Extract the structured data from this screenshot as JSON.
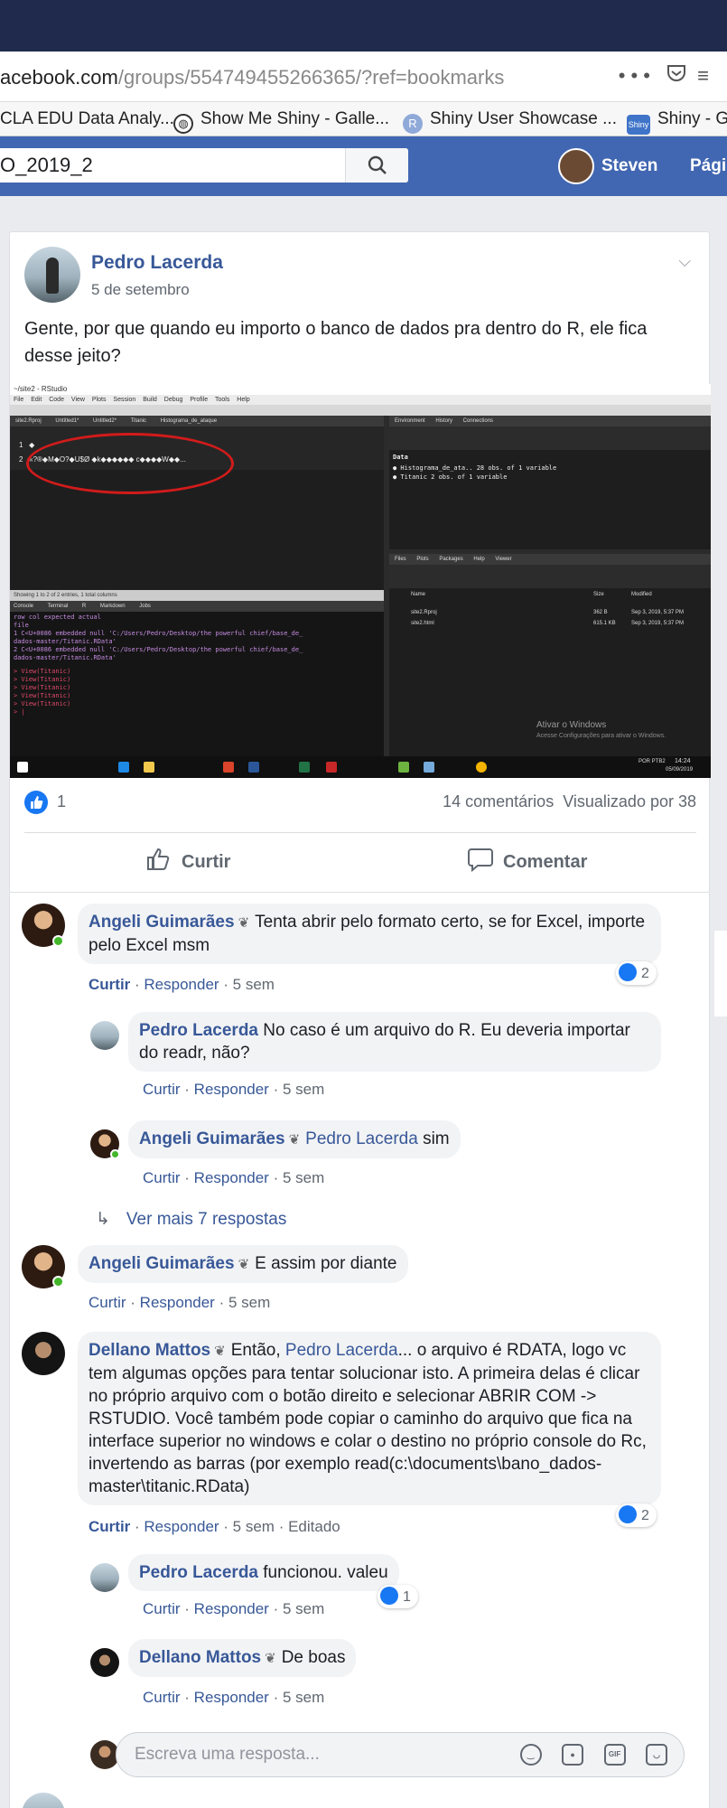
{
  "browser": {
    "url_prefix": "acebook.com",
    "url_path": "/groups/554749455266365/?ref=bookmarks",
    "menu_icon": "more-dots-icon",
    "pocket_icon": "pocket-icon",
    "bookmarks": [
      {
        "label": "CLA EDU Data Analy..."
      },
      {
        "label": "Show Me Shiny - Galle..."
      },
      {
        "label": "Shiny User Showcase ..."
      },
      {
        "label": "Shiny - Ga"
      }
    ]
  },
  "facebook": {
    "search_value": "O_2019_2",
    "user_name": "Steven",
    "page_link": "Pági",
    "brand_color": "#4267b2"
  },
  "post": {
    "author": "Pedro Lacerda",
    "date": "5 de setembro",
    "text": "Gente, por que quando eu importo o banco de dados pra dentro do R, ele fica desse jeito?",
    "like_count": "1",
    "comment_count": "14 comentários",
    "seen_by": "Visualizado por 38",
    "like_button": "Curtir",
    "comment_button": "Comentar"
  },
  "screenshot": {
    "title": "~/site2 - RStudio",
    "menu": "File  Edit  Code  View  Plots  Session  Build  Debug  Profile  Tools  Help",
    "left_tabs": "site2.Rproj  Untitled1*  Untitled2*  Titanic  Histograma_de_ataque",
    "grid_row1_num": "1",
    "grid_row1_val": "◆",
    "grid_row2_num": "2",
    "grid_row2_val": "«?®◆M◆O?◆U$Ø ◆k◆◆◆◆◆◆ c◆◆◆◆W◆◆...",
    "status": "Showing 1 to 2 of 2 entries, 1 total columns",
    "console_tabs": "Console  Terminal  R Markdown  Jobs",
    "console_lines": [
      "row            col expected        actual",
      "                       file",
      "  1 C<U+0086          embedded null 'C:/Users/Pedro/Desktop/the powerful chief/base_de_",
      "dados-master/Titanic.RData'",
      "  2 C<U+0086          embedded null 'C:/Users/Pedro/Desktop/the powerful chief/base_de_",
      "dados-master/Titanic.RData'",
      "> View(Titanic)",
      "> View(Titanic)",
      "> View(Titanic)",
      "> View(Titanic)",
      "> View(Titanic)",
      "> |"
    ],
    "env_tabs": "Environment  History  Connections",
    "env_header": "Data",
    "env_rows": [
      "● Histograma_de_ata..  28 obs. of 1 variable",
      "● Titanic               2 obs. of 1 variable"
    ],
    "files_tabs": "Files  Plots  Packages  Help  Viewer",
    "files_rows": [
      {
        "name": "site2.Rproj",
        "size": "362 B",
        "modified": "Sep 3, 2019, 5:37 PM"
      },
      {
        "name": "site2.html",
        "size": "615.1 KB",
        "modified": "Sep 3, 2019, 5:37 PM"
      }
    ],
    "files_header_name": "Name",
    "files_header_size": "Size",
    "files_header_modified": "Modified",
    "windows_activate": "Ativar o Windows",
    "windows_activate_sub": "Acesse Configurações para ativar o Windows.",
    "clock_time": "14:24",
    "clock_date": "05/09/2019",
    "lang": "POR PTB2"
  },
  "comments": [
    {
      "author": "Angeli Guimarães",
      "text": "Tenta abrir pelo formato certo, se for Excel, importe pelo Excel msm",
      "like": "Curtir",
      "reply": "Responder",
      "time": "5 sem",
      "reactions": "2"
    },
    {
      "author": "Pedro Lacerda",
      "text": "No caso é um arquivo do R. Eu deveria importar do readr, não?",
      "like": "Curtir",
      "reply": "Responder",
      "time": "5 sem"
    },
    {
      "author": "Angeli Guimarães",
      "mention": "Pedro Lacerda",
      "text": "sim",
      "like": "Curtir",
      "reply": "Responder",
      "time": "5 sem"
    },
    {
      "more_replies": "Ver mais 7 respostas"
    },
    {
      "author": "Angeli Guimarães",
      "text": "E assim por diante",
      "like": "Curtir",
      "reply": "Responder",
      "time": "5 sem"
    },
    {
      "author": "Dellano Mattos",
      "pre": "Então,",
      "mention": "Pedro Lacerda",
      "text": "... o arquivo é RDATA, logo vc tem algumas opções para tentar solucionar isto. A primeira delas é clicar no próprio arquivo com o botão direito e selecionar ABRIR COM -> RSTUDIO. Você também pode copiar o caminho do arquivo que fica na interface superior no windows e colar o destino no próprio console do Rc, invertendo as barras (por exemplo read(c:\\documents\\bano_dados-master\\titanic.RData)",
      "like": "Curtir",
      "reply": "Responder",
      "time": "5 sem",
      "edited": "Editado",
      "reactions": "2"
    },
    {
      "author": "Pedro Lacerda",
      "text": "funcionou. valeu",
      "like": "Curtir",
      "reply": "Responder",
      "time": "5 sem",
      "reactions": "1"
    },
    {
      "author": "Dellano Mattos",
      "text": "De boas",
      "like": "Curtir",
      "reply": "Responder",
      "time": "5 sem"
    }
  ],
  "reply_box": {
    "placeholder": "Escreva uma resposta...",
    "gif_label": "GIF"
  }
}
